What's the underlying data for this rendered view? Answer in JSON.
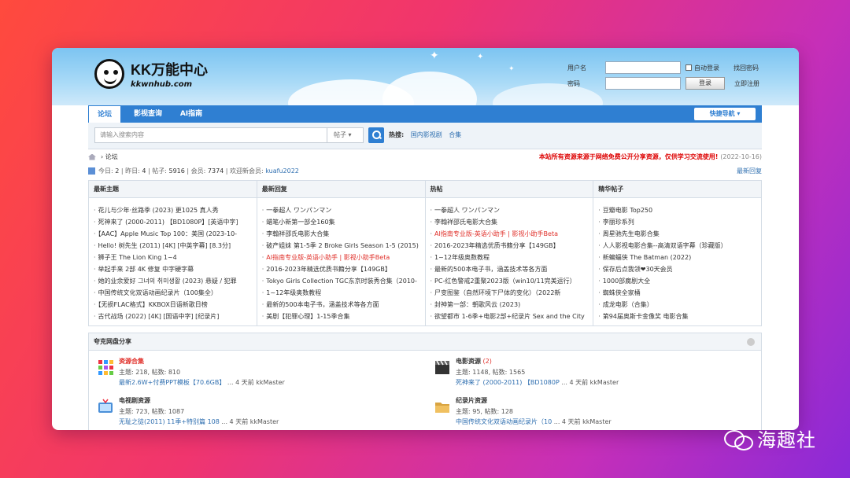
{
  "logo": {
    "title": "KK万能中心",
    "sub": "kkwnhub.com"
  },
  "login": {
    "username_label": "用户名",
    "password_label": "密码",
    "auto_login": "自动登录",
    "login_btn": "登录",
    "find_pw": "找回密码",
    "register": "立即注册"
  },
  "nav": {
    "tabs": [
      "论坛",
      "影视查询",
      "AI指南"
    ],
    "quick": "快捷导航 ▾"
  },
  "search": {
    "placeholder": "请输入搜索内容",
    "select": "帖子 ▾",
    "hot_label": "热搜:",
    "hot": [
      "国内影视剧",
      "合集"
    ]
  },
  "crumb": {
    "label": "论坛",
    "notice": "本站所有资源来源于网络免费公开分享资源，仅供学习交流使用!",
    "date": "(2022-10-16)"
  },
  "stats": {
    "today_l": "今日: ",
    "today": "2",
    "y_l": " | 昨日: ",
    "yesterday": "4",
    "p_l": " | 帖子: ",
    "posts": "5916",
    "m_l": " | 会员: ",
    "members": "7374",
    "w_l": " | 欢迎新会员: ",
    "newest": "kuafu2022",
    "latest": "最新回复"
  },
  "columns": [
    {
      "title": "最新主题",
      "items": [
        "花儿与少年·丝路季 (2023) 更1025 真人秀",
        "死神来了 (2000-2011) 【BD1080P】[英语中字]",
        "【AAC】Apple Music Top 100：美国 (2023-10-",
        "Hello! 树先生 (2011) [4K] [中英字幕] [8.3分]",
        "狮子王 The Lion King 1~4",
        "举起手来 2部 4K 修复 中字硬字幕",
        "她的业余爱好 그녀의 취미생활 (2023) 悬疑 / 犯罪",
        "中国传统文化双语动画纪录片（100集全）",
        "【无损FLAC格式】KKBOX日语新歌日榜",
        "古代战场 (2022) [4K] [国语中字] [纪录片]"
      ],
      "red": []
    },
    {
      "title": "最新回复",
      "items": [
        "一拳超人 ワンパンマン",
        "蜡笔小新第一部全160集",
        "李翰祥邵氏电影大合集",
        "破产姐妹 第1-5季 2 Broke Girls Season 1-5 (2015)",
        "AI指南专业版-英语小助手 | 影视小助手Beta",
        "2016-2023年精选优质书籍分享【149GB】",
        "Tokyo Girls Collection TGC东京时装秀合集（2010-",
        "1~12年级奥数教程",
        "最新的500本电子书，涵盖技术等各方面",
        "美剧【犯罪心理】1-15季合集"
      ],
      "red": [
        4
      ]
    },
    {
      "title": "热帖",
      "items": [
        "一拳超人 ワンパンマン",
        "李翰祥邵氏电影大合集",
        "AI指南专业版-英语小助手 | 影视小助手Beta",
        "2016-2023年精选优质书籍分享【149GB】",
        "1~12年级奥数教程",
        "最新的500本电子书，涵盖技术等各方面",
        "PC-红色警戒2重聚2023版（win10/11完美运行）",
        "尸变图鉴（自然环境下尸体的变化）（2022新",
        "封神第一部：朝歌风云 (2023)",
        "欲望都市 1-6季+电影2部+纪录片 Sex and the City"
      ],
      "red": [
        2
      ]
    },
    {
      "title": "精华帖子",
      "items": [
        "豆瓣电影 Top250",
        "李丽珍系列",
        "周星驰先生电影合集",
        "人人影视电影合集--高清双语字幕（珍藏版）",
        "新蝙蝠侠 The Batman (2022)",
        "保存后点我领❤30天会员",
        "1000部腐剧大全",
        "蜘蛛侠全家桶",
        "成龙电影（合集）",
        "第94届奥斯卡金像奖 电影合集"
      ],
      "red": []
    }
  ],
  "share": {
    "title": "夸克网盘分享",
    "forums": [
      {
        "name": "资源合集",
        "new": "",
        "stats": "主题: 218, 帖数: 810",
        "last_link": "最新2.6W+付费PPT模板【70.6GB】",
        "last_meta": " ... 4 天前 kkMaster",
        "icon": "grid-icon",
        "color": "#e0302a"
      },
      {
        "name": "电影资源",
        "new": " (2)",
        "stats": "主题: 1148, 帖数: 1565",
        "last_link": "死神来了 (2000-2011) 【BD1080P",
        "last_meta": " ... 4 天前 kkMaster",
        "icon": "clapperboard-icon",
        "color": "#333"
      },
      {
        "name": "电视剧资源",
        "new": "",
        "stats": "主题: 723, 帖数: 1087",
        "last_link": "无耻之徒(2011) 11季+特别篇 108",
        "last_meta": " ... 4 天前 kkMaster",
        "icon": "tv-icon",
        "color": "#333"
      },
      {
        "name": "纪录片资源",
        "new": "",
        "stats": "主题: 95, 帖数: 128",
        "last_link": "中国传统文化双语动画纪录片（10",
        "last_meta": " ... 4 天前 kkMaster",
        "icon": "folder-icon",
        "color": "#333"
      }
    ]
  },
  "watermark": "海趣社"
}
